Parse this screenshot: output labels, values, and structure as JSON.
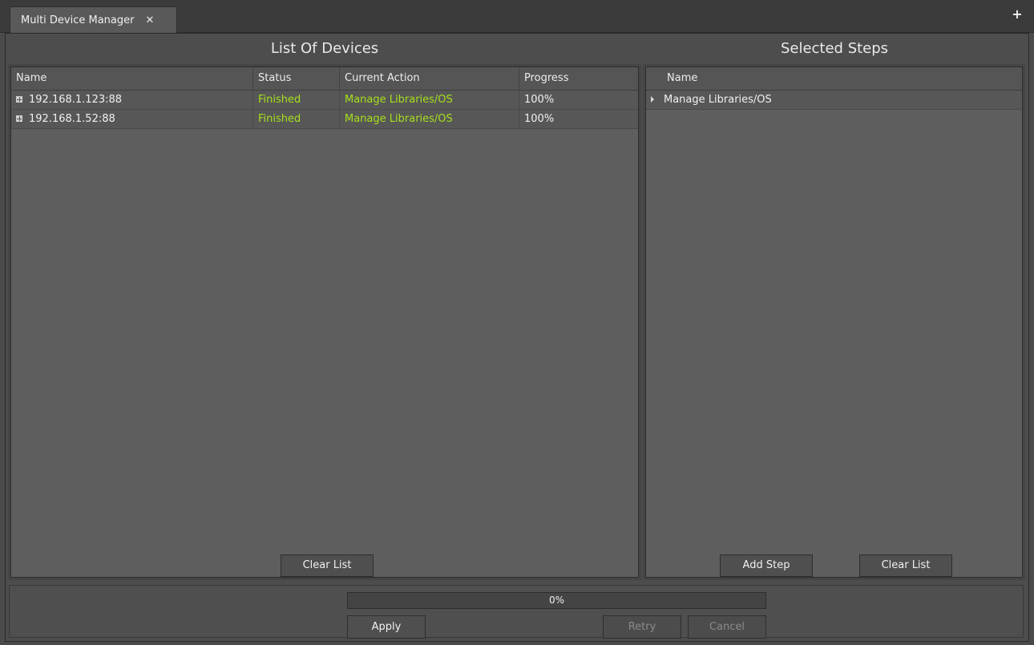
{
  "tab": {
    "title": "Multi Device Manager",
    "close_glyph": "✕"
  },
  "tabbar": {
    "add_glyph": "+"
  },
  "devices": {
    "title": "List Of Devices",
    "columns": [
      "Name",
      "Status",
      "Current Action",
      "Progress"
    ],
    "rows": [
      {
        "name": "192.168.1.123:88",
        "status": "Finished",
        "action": "Manage Libraries/OS",
        "progress": "100%"
      },
      {
        "name": "192.168.1.52:88",
        "status": "Finished",
        "action": "Manage Libraries/OS",
        "progress": "100%"
      }
    ],
    "clear_label": "Clear List"
  },
  "steps": {
    "title": "Selected Steps",
    "columns": [
      "Name"
    ],
    "rows": [
      {
        "name": "Manage Libraries/OS"
      }
    ],
    "add_label": "Add Step",
    "clear_label": "Clear List"
  },
  "footer": {
    "progress_text": "0%",
    "progress_value": 0,
    "apply_label": "Apply",
    "retry_label": "Retry",
    "cancel_label": "Cancel"
  },
  "colors": {
    "status_ok": "#a6e01c",
    "progress_fill": "#6aa617"
  }
}
